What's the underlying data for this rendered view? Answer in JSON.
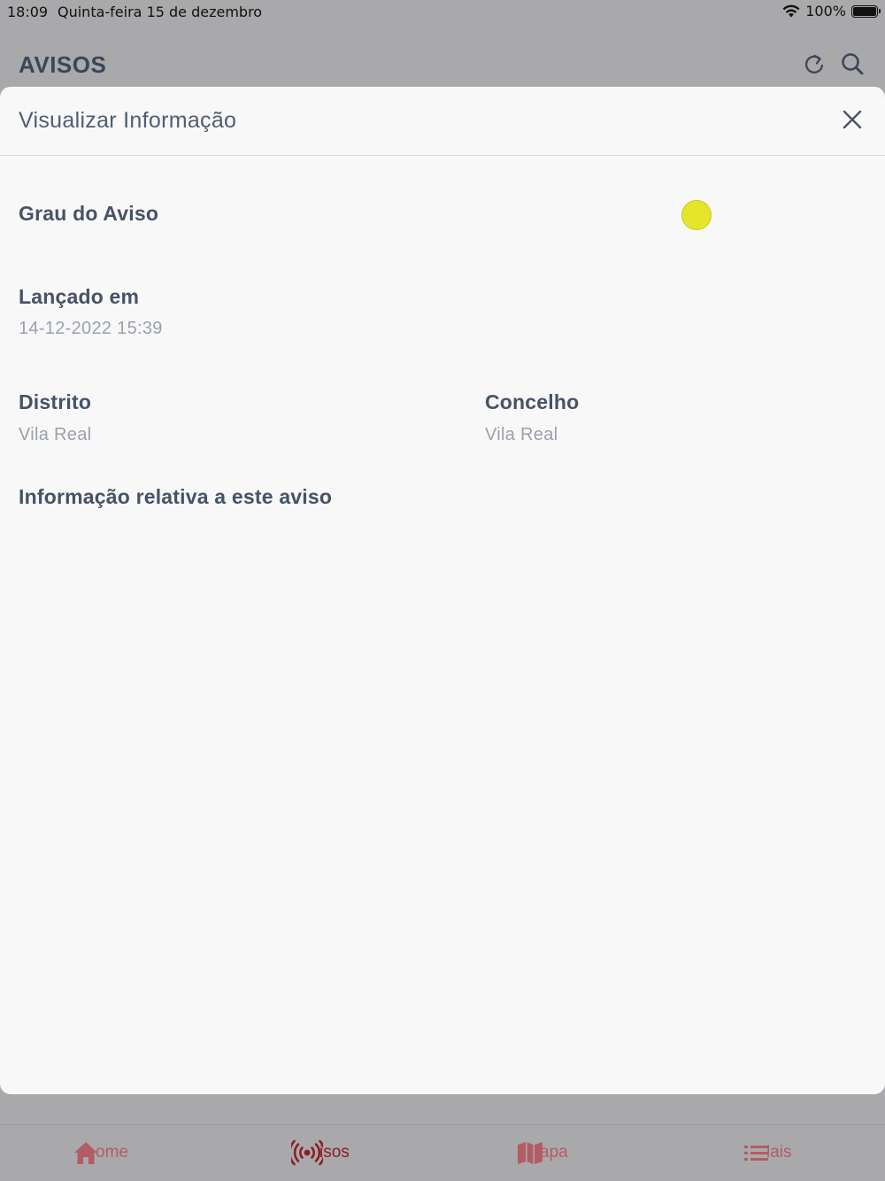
{
  "status": {
    "time": "18:09",
    "date": "Quinta-feira 15 de dezembro",
    "battery": "100%"
  },
  "header": {
    "title": "AVISOS"
  },
  "modal": {
    "title": "Visualizar Informação",
    "grade_label": "Grau do Aviso",
    "grade_color": "#e6e52a",
    "issued_label": "Lançado em",
    "issued_value": "14-12-2022 15:39",
    "district_label": "Distrito",
    "district_value": "Vila Real",
    "county_label": "Concelho",
    "county_value": "Vila Real",
    "info_label": "Informação relativa a este aviso"
  },
  "tabs": [
    {
      "label": "ome",
      "icon": "home-icon"
    },
    {
      "label": "isos",
      "icon": "broadcast-icon",
      "active": true
    },
    {
      "label": "apa",
      "icon": "map-icon"
    },
    {
      "label": "lais",
      "icon": "list-icon"
    }
  ]
}
